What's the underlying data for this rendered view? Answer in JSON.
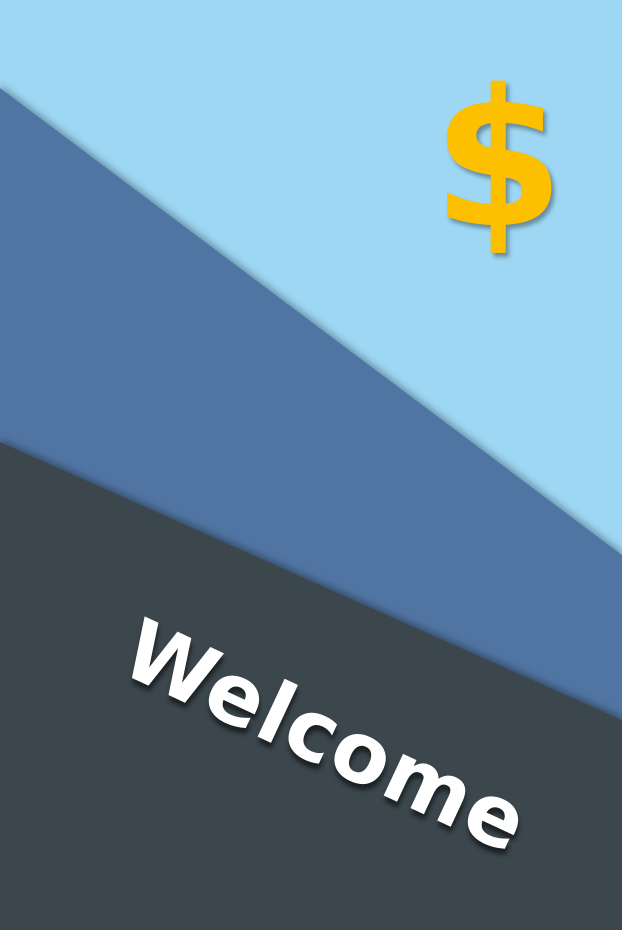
{
  "colors": {
    "sky": "#9dd7f3",
    "mid_band": "#5175a3",
    "dark_band": "#3a464d",
    "dollar": "#fcc000",
    "text": "#ffffff"
  },
  "icon": {
    "name": "dollar-icon",
    "glyph": "$"
  },
  "title": "Welcome"
}
